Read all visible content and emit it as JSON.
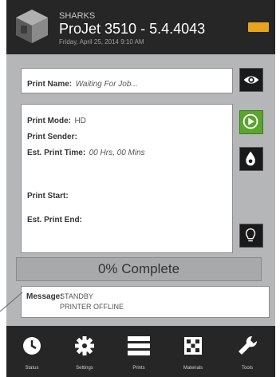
{
  "header": {
    "subtitle": "SHARKS",
    "title": "ProJet 3510 - 5.4.4043",
    "date": "Friday, April 25, 2014 9:10 AM"
  },
  "print_name": {
    "label": "Print Name:",
    "value": "Waiting For Job..."
  },
  "details": {
    "mode_label": "Print Mode:",
    "mode_value": "HD",
    "sender_label": "Print Sender:",
    "est_time_label": "Est. Print Time:",
    "est_time_value": "00 Hrs, 00 Mins",
    "start_label": "Print Start:",
    "end_label": "Est. Print End:"
  },
  "progress": {
    "text": "0% Complete",
    "percent": 0
  },
  "message": {
    "label": "Message:",
    "line1": "STANDBY",
    "line2": "PRINTER OFFLINE"
  },
  "nav": {
    "items": [
      {
        "label": "Status",
        "icon": "clock-icon"
      },
      {
        "label": "Settings",
        "icon": "gear-icon"
      },
      {
        "label": "Prints",
        "icon": "list-icon"
      },
      {
        "label": "Materials",
        "icon": "materials-icon"
      },
      {
        "label": "Tools",
        "icon": "wrench-icon"
      }
    ]
  },
  "colors": {
    "status_light": "#e5a51f",
    "play": "#5aa52e",
    "header": "#262626"
  }
}
